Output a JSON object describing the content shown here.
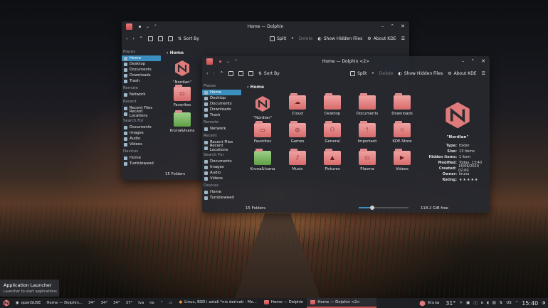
{
  "desktop": {
    "bg_icons": []
  },
  "window_back": {
    "title": "Home — Dolphin",
    "toolbar": {
      "split": "Split",
      "delete": "Delete",
      "show_hidden": "Show Hidden Files",
      "about": "About KDE",
      "sort_by": "Sort By"
    },
    "breadcrumb": "Home",
    "sidebar": {
      "places_label": "Places",
      "places": [
        "Home",
        "Desktop",
        "Documents",
        "Downloads",
        "Trash"
      ],
      "remote_label": "Remote",
      "remote": [
        "Network"
      ],
      "recent_label": "Recent",
      "recent": [
        "Recent Files",
        "Recent Locations"
      ],
      "search_label": "Search For",
      "search": [
        "Documents",
        "Images",
        "Audio",
        "Videos"
      ],
      "devices_label": "Devices",
      "devices": [
        "Home",
        "Tumbleweed"
      ]
    },
    "folders": [
      "\"Nordian\"",
      "Favorites",
      "Kruna&Ivana"
    ],
    "status": "15 Folders"
  },
  "window_front": {
    "title": "Home — Dolphin <2>",
    "toolbar": {
      "split": "Split",
      "delete": "Delete",
      "show_hidden": "Show Hidden Files",
      "about": "About KDE",
      "sort_by": "Sort By"
    },
    "breadcrumb": "Home",
    "sidebar": {
      "places_label": "Places",
      "places": [
        "Home",
        "Desktop",
        "Documents",
        "Downloads",
        "Trash"
      ],
      "remote_label": "Remote",
      "remote": [
        "Network"
      ],
      "recent_label": "Recent",
      "recent": [
        "Recent Files",
        "Recent Locations"
      ],
      "search_label": "Search For",
      "search": [
        "Documents",
        "Images",
        "Audio",
        "Videos"
      ],
      "devices_label": "Devices",
      "devices": [
        "Home",
        "Tumbleweed"
      ]
    },
    "folders": [
      {
        "name": "\"Nordian\"",
        "glyph": "nordian-logo"
      },
      {
        "name": "Cloud",
        "glyph": "☁"
      },
      {
        "name": "Desktop",
        "glyph": ""
      },
      {
        "name": "Documents",
        "glyph": ""
      },
      {
        "name": "Downloads",
        "glyph": ""
      },
      {
        "name": "Favorites",
        "glyph": "▭"
      },
      {
        "name": "Games",
        "glyph": "◎"
      },
      {
        "name": "General",
        "glyph": "⚇"
      },
      {
        "name": "Important",
        "glyph": "!"
      },
      {
        "name": "KDE-Store",
        "glyph": "☆"
      },
      {
        "name": "Kruna&Ivana",
        "glyph": "green"
      },
      {
        "name": "Music",
        "glyph": "♪"
      },
      {
        "name": "Pictures",
        "glyph": "▲"
      },
      {
        "name": "Plasma",
        "glyph": "▭"
      },
      {
        "name": "Videos",
        "glyph": "▶"
      }
    ],
    "status": "15 Folders",
    "free_space": "118.2 GiB free",
    "zoom_fraction": 0.27,
    "info": {
      "name": "\"Nordian\"",
      "rows": [
        {
          "k": "Type:",
          "v": "folder"
        },
        {
          "k": "Size:",
          "v": "13 items"
        },
        {
          "k": "Hidden items:",
          "v": "1 item"
        },
        {
          "k": "Modified:",
          "v": "Today, 13:40"
        },
        {
          "k": "Created:",
          "v": "16/06/2020 02:00"
        },
        {
          "k": "Owner:",
          "v": "kruna"
        },
        {
          "k": "Rating:",
          "v": "★★★★★"
        }
      ]
    }
  },
  "tooltip": {
    "title": "Application Launcher",
    "subtitle": "Launcher to start applications"
  },
  "taskbar": {
    "os_label": "openSUSE",
    "pager_label": "Home — Dolphin...",
    "temps": [
      "34°",
      "34°",
      "34°",
      "37°"
    ],
    "lang1": "lva",
    "lang2": "nx",
    "tasks": [
      "Linux, BSD i ostali *nix derivati - Mo...",
      "Home — Dolphin",
      "Home — Dolphin <2>"
    ],
    "user": "Kruna",
    "weather": "31°",
    "keyboard": "US",
    "clock": "15:40"
  },
  "colors": {
    "accent": "#3b8fbf",
    "folder": "#e08d8d",
    "active_task": "#c85050"
  }
}
